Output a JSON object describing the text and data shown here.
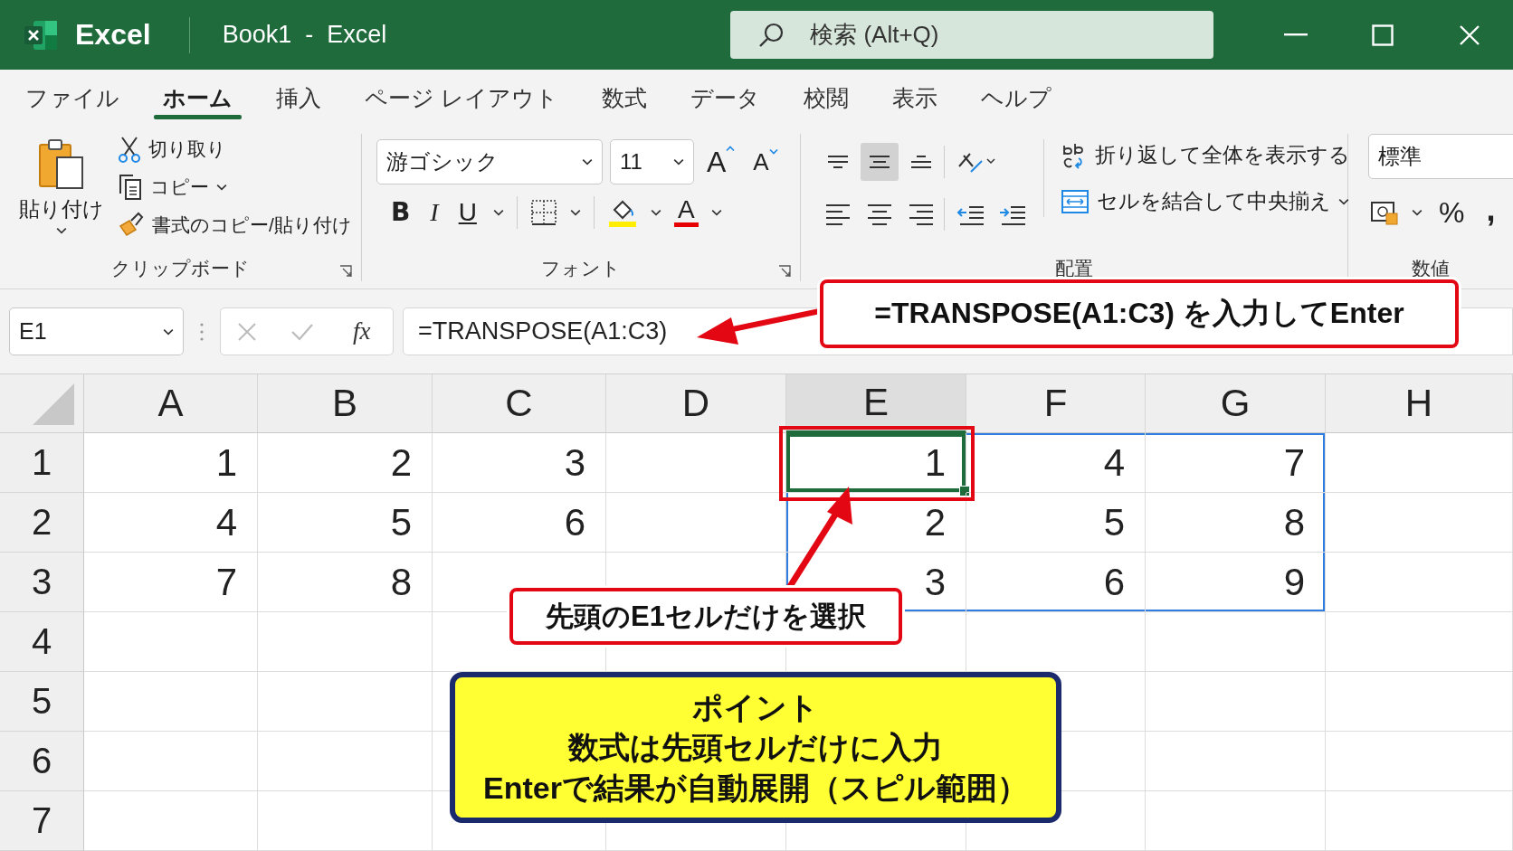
{
  "title_bar": {
    "app_name": "Excel",
    "document": "Book1  -  Excel",
    "search": {
      "placeholder": "検索 (Alt+Q)"
    }
  },
  "tabs": [
    {
      "label": "ファイル",
      "selected": false
    },
    {
      "label": "ホーム",
      "selected": true
    },
    {
      "label": "挿入",
      "selected": false
    },
    {
      "label": "ページ レイアウト",
      "selected": false
    },
    {
      "label": "数式",
      "selected": false
    },
    {
      "label": "データ",
      "selected": false
    },
    {
      "label": "校閲",
      "selected": false
    },
    {
      "label": "表示",
      "selected": false
    },
    {
      "label": "ヘルプ",
      "selected": false
    }
  ],
  "ribbon": {
    "clipboard": {
      "paste": "貼り付け",
      "cut": "切り取り",
      "copy": "コピー",
      "format_painter": "書式のコピー/貼り付け",
      "label": "クリップボード"
    },
    "font": {
      "font_name": "游ゴシック",
      "font_size": "11",
      "grow": "A",
      "shrink": "A",
      "bold": "B",
      "italic": "I",
      "underline": "U",
      "font_color": "A",
      "label": "フォント"
    },
    "alignment": {
      "vertical_align": [
        {
          "kind": "top",
          "selected": false
        },
        {
          "kind": "middle",
          "selected": true
        },
        {
          "kind": "bottom",
          "selected": false
        }
      ],
      "horizontal_align": [
        {
          "kind": "left",
          "selected": false
        },
        {
          "kind": "center",
          "selected": false
        },
        {
          "kind": "right",
          "selected": false
        }
      ],
      "wrap_text": "折り返して全体を表示する",
      "merge": "セルを結合して中央揃え",
      "label": "配置"
    },
    "number": {
      "format": "標準",
      "percent": "%",
      "comma": ",",
      "label": "数値"
    }
  },
  "formula_bar": {
    "name_box": "E1",
    "fx": "fx",
    "formula": "=TRANSPOSE(A1:C3)"
  },
  "sheet": {
    "columns": [
      {
        "label": "A",
        "selected": false
      },
      {
        "label": "B",
        "selected": false
      },
      {
        "label": "C",
        "selected": false
      },
      {
        "label": "D",
        "selected": false
      },
      {
        "label": "E",
        "selected": true
      },
      {
        "label": "F",
        "selected": false
      },
      {
        "label": "G",
        "selected": false
      },
      {
        "label": "H",
        "selected": false
      }
    ],
    "rows": [
      {
        "header": "1",
        "cells": [
          {
            "value": "1",
            "selected": false
          },
          {
            "value": "2",
            "selected": false
          },
          {
            "value": "3",
            "selected": false
          },
          null,
          {
            "value": "1",
            "selected": true
          },
          {
            "value": "4",
            "selected": false
          },
          {
            "value": "7",
            "selected": false
          },
          null
        ]
      },
      {
        "header": "2",
        "cells": [
          {
            "value": "4",
            "selected": false
          },
          {
            "value": "5",
            "selected": false
          },
          {
            "value": "6",
            "selected": false
          },
          null,
          {
            "value": "2",
            "selected": false
          },
          {
            "value": "5",
            "selected": false
          },
          {
            "value": "8",
            "selected": false
          },
          null
        ]
      },
      {
        "header": "3",
        "cells": [
          {
            "value": "7",
            "selected": false
          },
          {
            "value": "8",
            "selected": false
          },
          null,
          null,
          {
            "value": "3",
            "selected": false
          },
          {
            "value": "6",
            "selected": false
          },
          {
            "value": "9",
            "selected": false
          },
          null
        ]
      },
      {
        "header": "4",
        "cells": [
          null,
          null,
          null,
          null,
          null,
          null,
          null,
          null
        ]
      },
      {
        "header": "5",
        "cells": [
          null,
          null,
          null,
          null,
          null,
          null,
          null,
          null
        ]
      },
      {
        "header": "6",
        "cells": [
          null,
          null,
          null,
          null,
          null,
          null,
          null,
          null
        ]
      },
      {
        "header": "7",
        "cells": [
          null,
          null,
          null,
          null,
          null,
          null,
          null,
          null
        ]
      }
    ]
  },
  "annotations": [
    {
      "kind": "formula-callout",
      "text": "=TRANSPOSE(A1:C3) を入力してEnter"
    },
    {
      "kind": "cell-callout",
      "text": "先頭のE1セルだけを選択"
    },
    {
      "kind": "note",
      "lines": [
        "ポイント",
        "数式は先頭セルだけに入力",
        "Enterで結果が自動展開（スピル範囲）"
      ]
    }
  ]
}
